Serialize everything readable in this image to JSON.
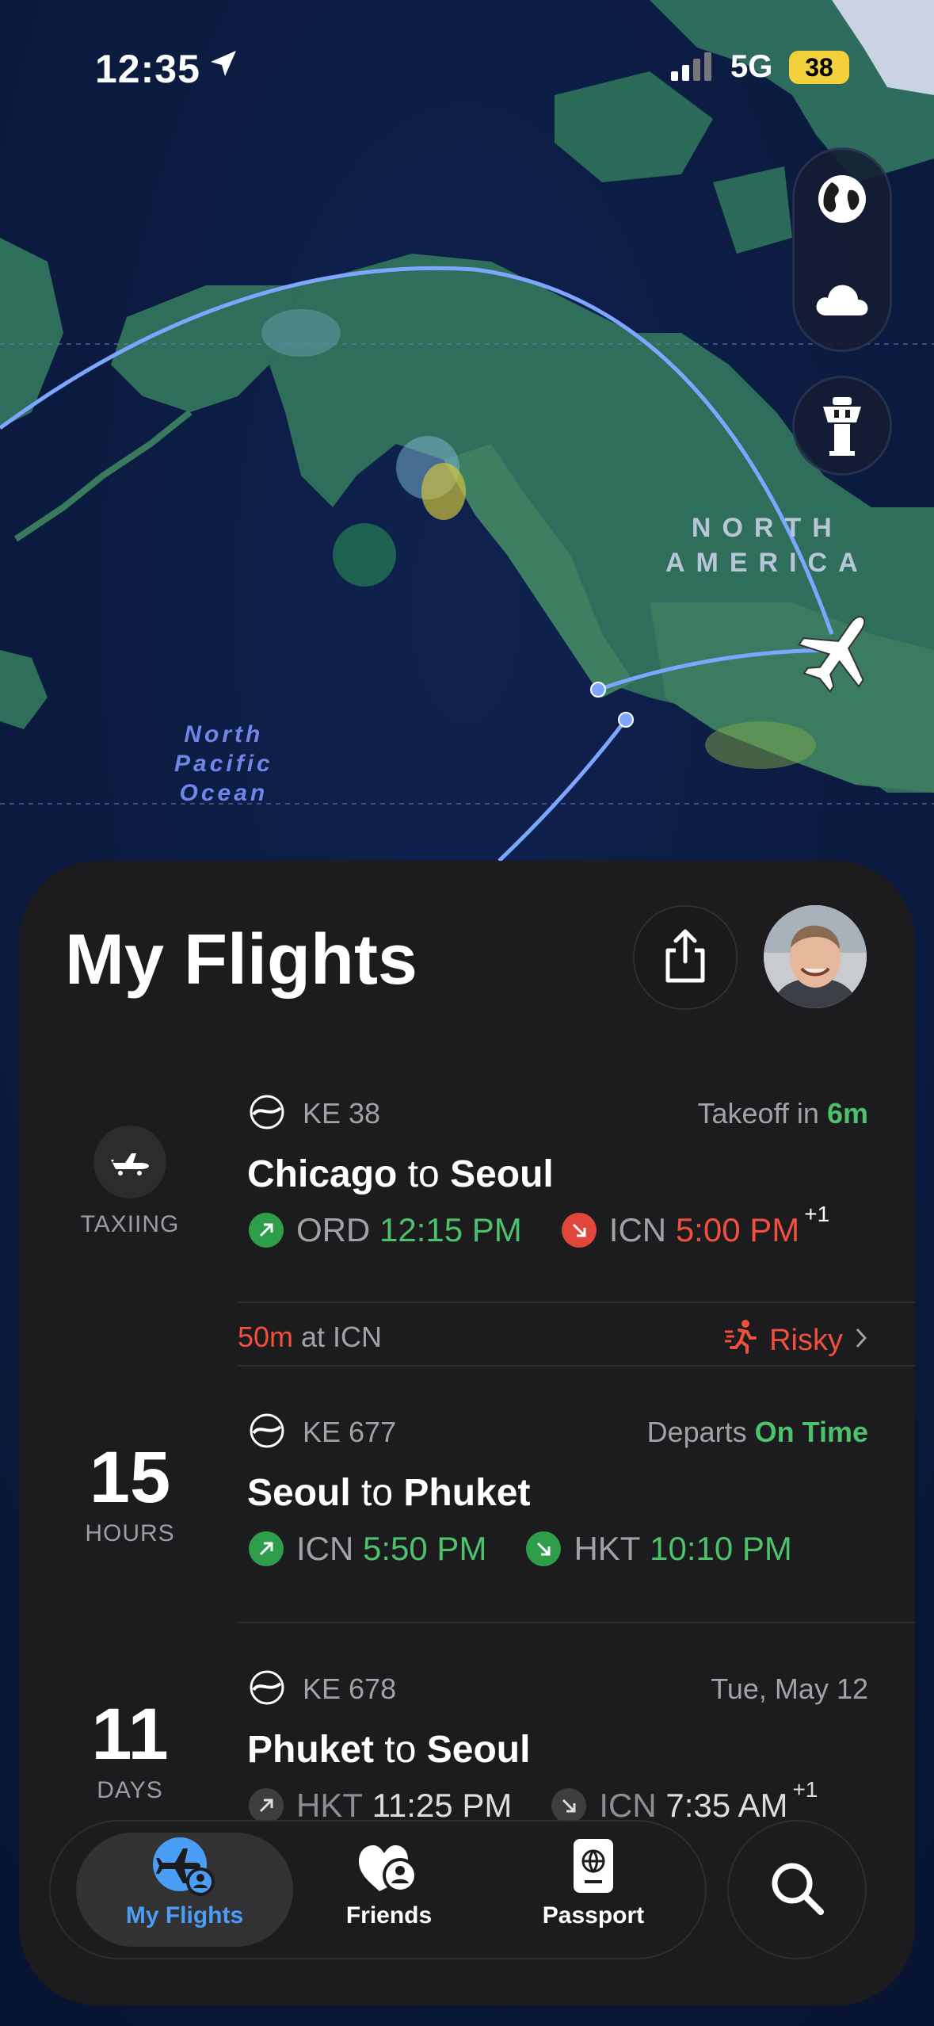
{
  "status_bar": {
    "time": "12:35",
    "network": "5G",
    "battery": "38"
  },
  "map": {
    "continent_label_line1": "NORTH",
    "continent_label_line2": "AMERICA",
    "ocean_label_line1": "North",
    "ocean_label_line2": "Pacific",
    "ocean_label_line3": "Ocean"
  },
  "map_controls": {
    "globe": "globe-icon",
    "weather": "cloud-icon",
    "tower": "tower-icon"
  },
  "sheet": {
    "title": "My Flights"
  },
  "flights": [
    {
      "left_caption": "TAXIING",
      "flight_number": "KE 38",
      "status_prefix": "Takeoff in ",
      "status_value": "6m",
      "origin_city": "Chicago",
      "to_word": "to",
      "dest_city": "Seoul",
      "dep_code": "ORD",
      "dep_time": "12:15 PM",
      "arr_code": "ICN",
      "arr_time": "5:00 PM",
      "day_offset": "+1"
    },
    {
      "left_number": "15",
      "left_caption": "HOURS",
      "flight_number": "KE 677",
      "status_prefix": "Departs ",
      "status_value": "On Time",
      "origin_city": "Seoul",
      "to_word": "to",
      "dest_city": "Phuket",
      "dep_code": "ICN",
      "dep_time": "5:50 PM",
      "arr_code": "HKT",
      "arr_time": "10:10 PM"
    },
    {
      "left_number": "11",
      "left_caption": "DAYS",
      "flight_number": "KE 678",
      "status_value": "Tue, May 12",
      "origin_city": "Phuket",
      "to_word": "to",
      "dest_city": "Seoul",
      "dep_code": "HKT",
      "dep_time": "11:25 PM",
      "arr_code": "ICN",
      "arr_time": "7:35 AM",
      "day_offset": "+1"
    }
  ],
  "connection": {
    "layover_value": "50m",
    "layover_suffix": " at ICN",
    "risk_label": "Risky"
  },
  "tabs": [
    {
      "label": "My Flights",
      "active": true
    },
    {
      "label": "Friends"
    },
    {
      "label": "Passport"
    }
  ],
  "colors": {
    "accent_green": "#4cc26a",
    "accent_red": "#f0503c",
    "active_tab": "#4a9ef5",
    "battery": "#f2d13c"
  }
}
